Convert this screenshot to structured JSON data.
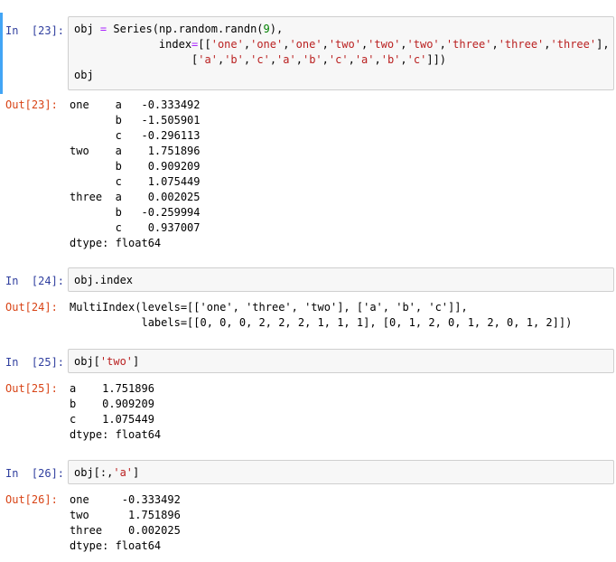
{
  "cells": [
    {
      "in_prompt": "In  [23]:",
      "out_prompt": "Out[23]:",
      "code": {
        "l1_a": "obj ",
        "l1_op": "=",
        "l1_b": " Series(np.random.randn(",
        "l1_num": "9",
        "l1_c": "),",
        "l2_a": "             index",
        "l2_op": "=",
        "l2_b": "[[",
        "l2_s1": "'one'",
        "l2_c1": ",",
        "l2_s2": "'one'",
        "l2_c2": ",",
        "l2_s3": "'one'",
        "l2_c3": ",",
        "l2_s4": "'two'",
        "l2_c4": ",",
        "l2_s5": "'two'",
        "l2_c5": ",",
        "l2_s6": "'two'",
        "l2_c6": ",",
        "l2_s7": "'three'",
        "l2_c7": ",",
        "l2_s8": "'three'",
        "l2_c8": ",",
        "l2_s9": "'three'",
        "l2_end": "],",
        "l3_a": "                  [",
        "l3_s1": "'a'",
        "l3_c1": ",",
        "l3_s2": "'b'",
        "l3_c2": ",",
        "l3_s3": "'c'",
        "l3_c3": ",",
        "l3_s4": "'a'",
        "l3_c4": ",",
        "l3_s5": "'b'",
        "l3_c5": ",",
        "l3_s6": "'c'",
        "l3_c6": ",",
        "l3_s7": "'a'",
        "l3_c7": ",",
        "l3_s8": "'b'",
        "l3_c8": ",",
        "l3_s9": "'c'",
        "l3_end": "]])",
        "l4": "obj"
      },
      "output": "one    a   -0.333492\n       b   -1.505901\n       c   -0.296113\ntwo    a    1.751896\n       b    0.909209\n       c    1.075449\nthree  a    0.002025\n       b   -0.259994\n       c    0.937007\ndtype: float64"
    },
    {
      "in_prompt": "In  [24]:",
      "out_prompt": "Out[24]:",
      "code": {
        "text": "obj.index"
      },
      "output": "MultiIndex(levels=[['one', 'three', 'two'], ['a', 'b', 'c']],\n           labels=[[0, 0, 0, 2, 2, 2, 1, 1, 1], [0, 1, 2, 0, 1, 2, 0, 1, 2]])"
    },
    {
      "in_prompt": "In  [25]:",
      "out_prompt": "Out[25]:",
      "code": {
        "a": "obj[",
        "s": "'two'",
        "b": "]"
      },
      "output": "a    1.751896\nb    0.909209\nc    1.075449\ndtype: float64"
    },
    {
      "in_prompt": "In  [26]:",
      "out_prompt": "Out[26]:",
      "code": {
        "a": "obj[:,",
        "s": "'a'",
        "b": "]"
      },
      "output": "one     -0.333492\ntwo      1.751896\nthree    0.002025\ndtype: float64"
    }
  ],
  "colors": {
    "in_prompt": "#303f9f",
    "out_prompt": "#d84315",
    "string": "#ba2121",
    "number": "#008000",
    "operator": "#aa22ff",
    "selected_bar": "#42a5f5",
    "input_bg": "#f7f7f7",
    "input_border": "#cfcfcf"
  }
}
